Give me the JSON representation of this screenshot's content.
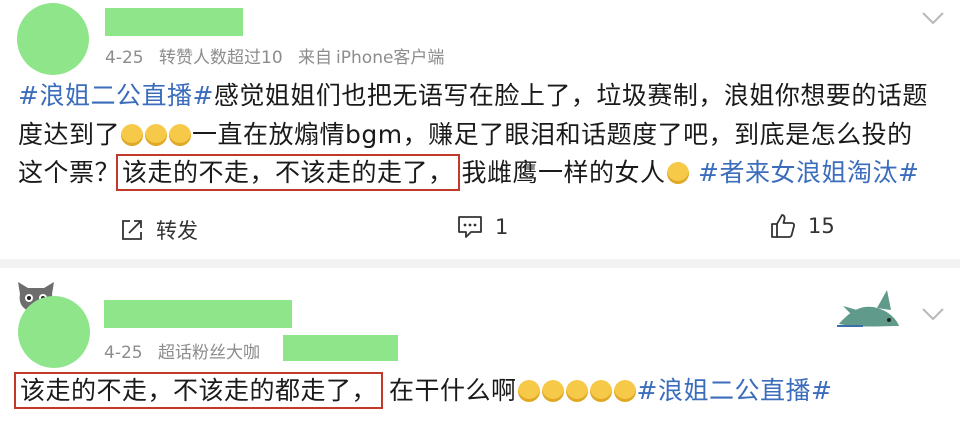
{
  "post1": {
    "date": "4-25",
    "reposts_over": "转赞人数超过10",
    "source_prefix": "来自",
    "source": "iPhone客户端",
    "text": {
      "hashtag1": "#浪姐二公直播#",
      "line1_rest": "感觉姐姐们也把无语写在脸上了，垃圾赛制，浪姐你想要的话题",
      "line2_start": "度达到了",
      "line2_end": "一直在放煽情bgm，赚足了眼泪和话题度了吧，到底是怎么投的",
      "line3_start": "这个票？",
      "highlight": "该走的不走，不该走的走了，",
      "line3_mid": "我雌鹰一样的女人",
      "hashtag2": "#者来女浪姐淘汰#"
    },
    "actions": {
      "repost_label": "转发",
      "comment_count": "1",
      "like_count": "15"
    }
  },
  "post2": {
    "date": "4-25",
    "badge": "超话粉丝大咖",
    "text": {
      "highlight": "该走的不走，不该走的都走了，",
      "rest": "在干什么啊",
      "hashtag": "#浪姐二公直播#"
    }
  },
  "icons": {
    "chevron": "chevron-down-icon",
    "repost": "repost-icon",
    "comment": "comment-icon",
    "like": "thumbs-up-icon"
  },
  "colors": {
    "hashtag": "#3b6dbc",
    "highlight_box": "#c0392b",
    "redaction": "#8fe58a"
  }
}
